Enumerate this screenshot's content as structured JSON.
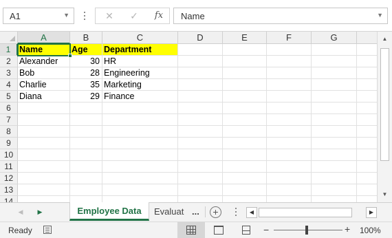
{
  "formula_bar": {
    "name_box": "A1",
    "cancel_icon": "✕",
    "enter_icon": "✓",
    "fx_label": "fx",
    "content": "Name"
  },
  "columns": [
    "A",
    "B",
    "C",
    "D",
    "E",
    "F",
    "G"
  ],
  "rows": [
    "1",
    "2",
    "3",
    "4",
    "5",
    "6",
    "7",
    "8",
    "9",
    "10",
    "11",
    "12",
    "13",
    "14"
  ],
  "cells": {
    "A1": "Name",
    "B1": "Age",
    "C1": "Department",
    "A2": "Alexander",
    "B2": "30",
    "C2": "HR",
    "A3": "Bob",
    "B3": "28",
    "C3": "Engineering",
    "A4": "Charlie",
    "B4": "35",
    "C4": "Marketing",
    "A5": "Diana",
    "B5": "29",
    "C5": "Finance"
  },
  "header_fill_color": "#ffff00",
  "accent_color": "#217346",
  "sheet_tabs": {
    "active": "Employee Data",
    "other": "Evaluat",
    "more": "..."
  },
  "status_bar": {
    "ready": "Ready",
    "zoom": "100%",
    "zoom_minus": "−",
    "zoom_plus": "+"
  },
  "icons": {
    "name_box_dropdown": "chevron-down-icon",
    "formula_dropdown": "chevron-down-icon",
    "add_sheet": "plus-circle-icon",
    "scroll_left": "triangle-left-icon",
    "scroll_right": "triangle-right-icon",
    "scroll_up": "triangle-up-icon",
    "scroll_down": "triangle-down-icon"
  }
}
